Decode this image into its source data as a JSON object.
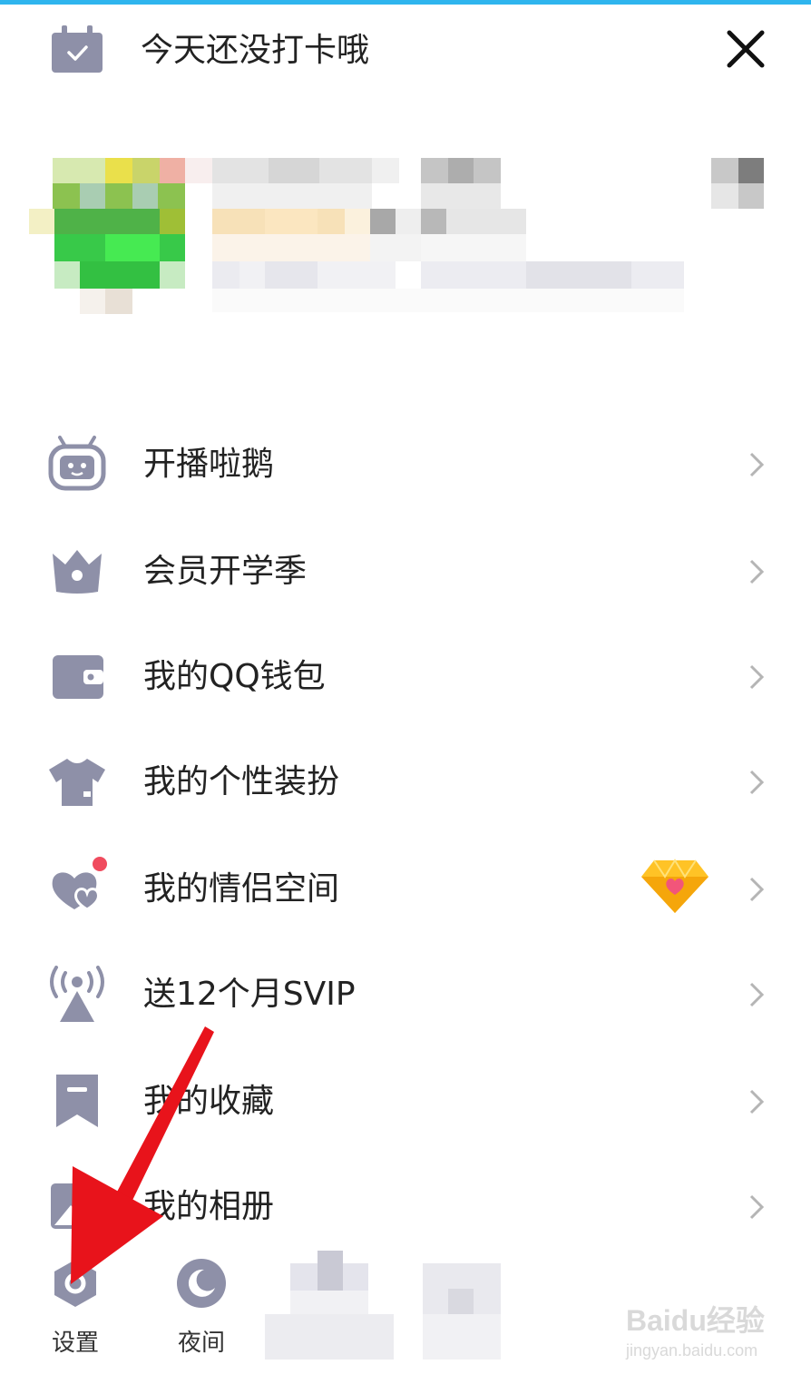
{
  "checkin": {
    "label": "今天还没打卡哦",
    "icon": "calendar-check-icon"
  },
  "close": {
    "icon": "close-icon"
  },
  "menu": {
    "items": [
      {
        "label": "开播啦鹅",
        "icon": "tv-robot-icon"
      },
      {
        "label": "会员开学季",
        "icon": "crown-icon"
      },
      {
        "label": "我的QQ钱包",
        "icon": "wallet-icon"
      },
      {
        "label": "我的个性装扮",
        "icon": "tshirt-icon"
      },
      {
        "label": "我的情侣空间",
        "icon": "hearts-icon",
        "badge": "red-dot",
        "vip": "diamond-heart-icon"
      },
      {
        "label": "送12个月SVIP",
        "icon": "broadcast-tower-icon"
      },
      {
        "label": "我的收藏",
        "icon": "bookmark-icon"
      },
      {
        "label": "我的相册",
        "icon": "photo-icon"
      }
    ]
  },
  "bottom": {
    "settings": {
      "label": "设置",
      "icon": "settings-hex-icon"
    },
    "night": {
      "label": "夜间",
      "icon": "moon-icon"
    }
  },
  "watermark": {
    "line1": "Baidu经验",
    "line2": "jingyan.baidu.com"
  },
  "colors": {
    "icon_gray": "#8e90a8",
    "accent_blue": "#2fb5ee",
    "badge_red": "#f04b5e",
    "arrow_red": "#e8131b"
  }
}
